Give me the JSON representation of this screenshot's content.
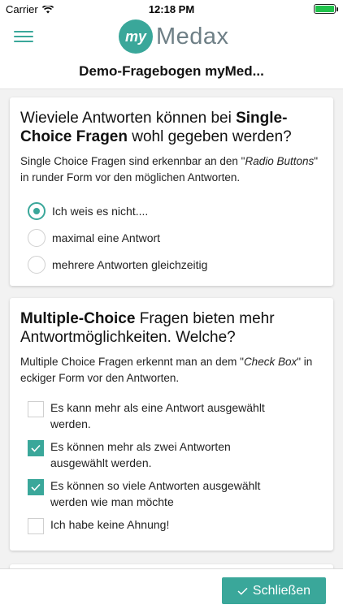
{
  "status_bar": {
    "carrier": "Carrier",
    "time": "12:18 PM",
    "battery_level": 1.0
  },
  "header": {
    "logo_prefix": "my",
    "logo_word": "Medax"
  },
  "page": {
    "title": "Demo-Fragebogen myMed..."
  },
  "questions": [
    {
      "title_pre": "Wieviele Antworten können bei ",
      "title_bold": "Single-Choice Fragen",
      "title_post": " wohl gegeben werden?",
      "desc_pre": "Single Choice Fragen sind erkennbar an den \"",
      "desc_italic": "Radio Buttons",
      "desc_post": "\" in runder Form vor den möglichen Antworten.",
      "options": [
        {
          "label": "Ich weis es nicht....",
          "selected": true
        },
        {
          "label": "maximal eine Antwort",
          "selected": false
        },
        {
          "label": "mehrere Antworten gleichzeitig",
          "selected": false
        }
      ]
    },
    {
      "title_bold": "Multiple-Choice",
      "title_post": " Fragen bieten mehr Antwortmöglichkeiten. Welche?",
      "desc_pre": "Multiple Choice Fragen erkennt man an dem \"",
      "desc_italic": "Check Box",
      "desc_post": "\" in eckiger Form vor den Antworten.",
      "options": [
        {
          "label": "Es kann mehr als eine Antwort ausgewählt werden.",
          "checked": false
        },
        {
          "label": "Es können mehr als zwei Antworten ausgewählt werden.",
          "checked": true
        },
        {
          "label": "Es können so viele Antworten ausgewählt werden wie man möchte",
          "checked": true
        },
        {
          "label": "Ich habe keine Ahnung!",
          "checked": false
        }
      ]
    }
  ],
  "footer": {
    "close_label": "Schließen"
  },
  "colors": {
    "accent": "#3aa79a",
    "logo_text": "#6e7f86",
    "background": "#f2f2f2"
  }
}
